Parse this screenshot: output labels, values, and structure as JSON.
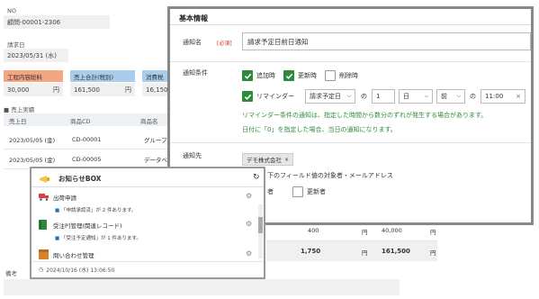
{
  "background": {
    "no_label": "NO",
    "no_value": "顧問-00001-2306",
    "date_label": "請求日",
    "date_value": "2023/05/31 (水)",
    "tags": [
      {
        "label": "工程内容総料",
        "color": "#f4a582"
      },
      {
        "label": "売上合計(税別)",
        "color": "#a9cdea"
      },
      {
        "label": "消費税",
        "color": "#a9cdea"
      }
    ],
    "amounts": [
      "30,000",
      "161,500",
      "16,150"
    ],
    "yen": "円",
    "section_title": "■ 売上実績",
    "table_headers": [
      "売上日",
      "商品CD",
      "商品名"
    ],
    "rows": [
      {
        "date": "2023/05/05 (金)",
        "code": "CD-00001",
        "name": "グループ"
      },
      {
        "date": "2023/05/05 (金)",
        "code": "CD-00005",
        "name": "データベ"
      }
    ],
    "bottom_values": [
      {
        "a": "400",
        "b": "40,000"
      },
      {
        "a": "1,750",
        "b": "161,500"
      }
    ],
    "remarks_label": "備考"
  },
  "panel": {
    "title": "基本情報",
    "notify_name_label": "通知名",
    "required": "[必須]",
    "notify_name_value": "請求予定日前日通知",
    "condition_label": "通知条件",
    "check_add": "追加時",
    "check_update": "更新時",
    "check_delete": "削除時",
    "check_reminder": "リマインダー",
    "reminder_field": "請求予定日",
    "no1": "の",
    "days_value": "1",
    "unit": "日",
    "direction": "前",
    "no2": "の",
    "time": "11:00",
    "clear": "×",
    "note1": "リマインダー条件の通知は、指定した時間から数分のずれが発生する場合があります。",
    "note2": "日付に「0」を指定した場合、当日の通知になります。",
    "target_label": "通知先",
    "target_chip": "デモ株式会社",
    "field_text": "下のフィールド値の対象者・メールアドレス",
    "creator": "者",
    "updater": "更新者"
  },
  "notif": {
    "title": "お知らせBOX",
    "items": [
      {
        "title": "出荷申請",
        "sub": "「申請承認済」が 2 件あります。",
        "color": "#d94040"
      },
      {
        "title": "受注P]管理(関連レコード)",
        "sub": "「受注予定通知」が 1 件あります。",
        "color": "#2e8b3c"
      },
      {
        "title": "問い合わせ管理",
        "sub": "",
        "color": "#d9822b"
      }
    ],
    "timestamp": "2024/10/16 (水) 13:06:50"
  }
}
